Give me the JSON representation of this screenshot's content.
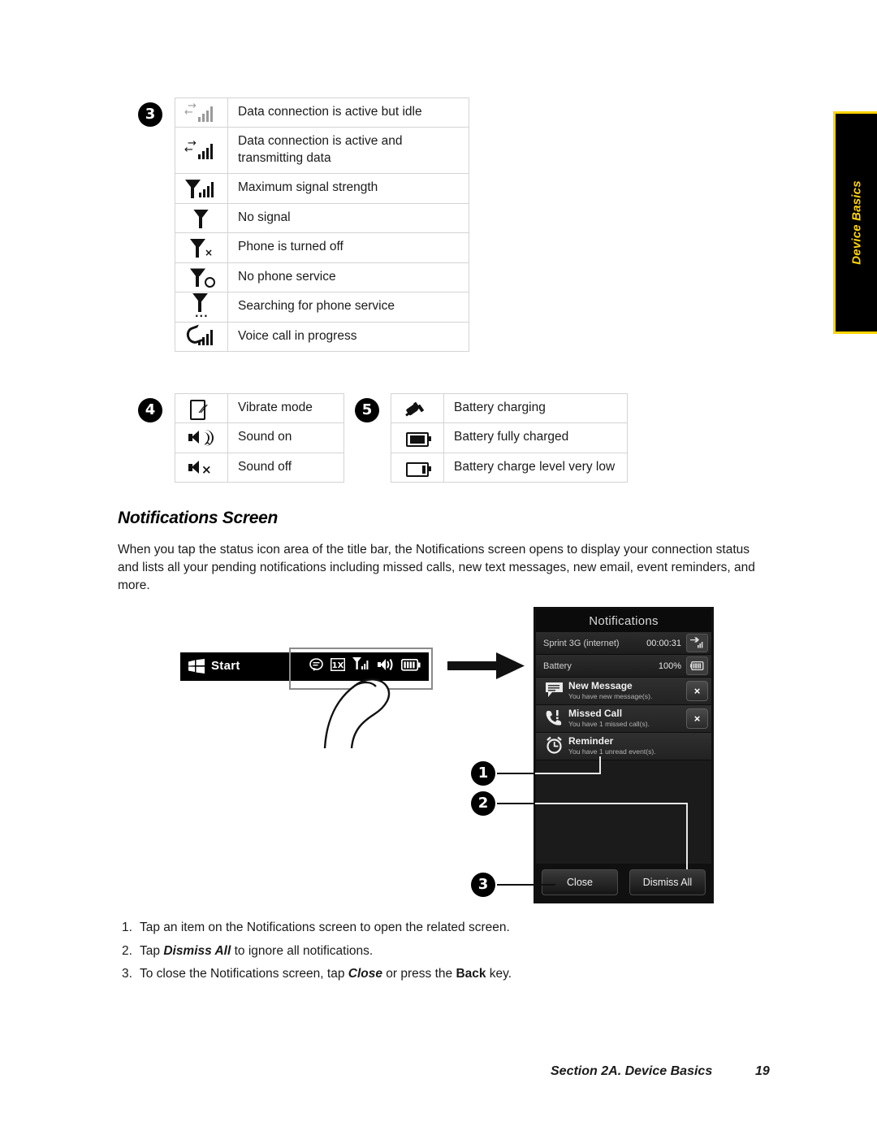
{
  "side_tab": {
    "label": "Device Basics",
    "bg": "#000000",
    "accent": "#ffd400"
  },
  "tables": [
    {
      "callout": "3",
      "rows": [
        {
          "icon": "data-connection-idle-icon",
          "text": "Data connection is active but idle"
        },
        {
          "icon": "data-connection-transmitting-icon",
          "text": "Data connection is active and transmitting data"
        },
        {
          "icon": "signal-max-icon",
          "text": "Maximum signal strength"
        },
        {
          "icon": "no-signal-icon",
          "text": "No signal"
        },
        {
          "icon": "phone-off-icon",
          "text": "Phone is turned off"
        },
        {
          "icon": "no-phone-service-icon",
          "text": "No phone service"
        },
        {
          "icon": "searching-service-icon",
          "text": "Searching for phone service"
        },
        {
          "icon": "voice-call-icon",
          "text": "Voice call in progress"
        }
      ]
    },
    {
      "callout": "4",
      "rows": [
        {
          "icon": "vibrate-icon",
          "text": "Vibrate mode"
        },
        {
          "icon": "sound-on-icon",
          "text": "Sound on"
        },
        {
          "icon": "sound-off-icon",
          "text": "Sound off"
        }
      ]
    },
    {
      "callout": "5",
      "rows": [
        {
          "icon": "battery-charging-icon",
          "text": "Battery charging"
        },
        {
          "icon": "battery-full-icon",
          "text": "Battery fully charged"
        },
        {
          "icon": "battery-low-icon",
          "text": "Battery charge level very low"
        }
      ]
    }
  ],
  "section": {
    "heading": "Notifications Screen",
    "paragraph": "When you tap the status icon area of the title bar, the Notifications screen opens to display your connection status and lists all your pending notifications including missed calls, new text messages, new email, event reminders, and more."
  },
  "illustration": {
    "titlebar": {
      "start_label": "Start",
      "icons": [
        "messaging-icon",
        "1x-icon",
        "signal-icon",
        "sound-on-icon",
        "battery-icon"
      ],
      "onex_label": "1X"
    },
    "callouts": [
      "1",
      "2",
      "3"
    ]
  },
  "phone": {
    "title": "Notifications",
    "status_rows": [
      {
        "label": "Sprint 3G (internet)",
        "value": "00:00:31",
        "icon": "data-connection-icon"
      },
      {
        "label": "Battery",
        "value": "100%",
        "icon": "battery-full-icon"
      }
    ],
    "notifications": [
      {
        "icon": "message-icon",
        "title": "New Message",
        "detail": "You have new message(s).",
        "dismiss": "×"
      },
      {
        "icon": "missed-call-icon",
        "title": "Missed Call",
        "detail": "You have 1 missed call(s).",
        "dismiss": "×"
      },
      {
        "icon": "alarm-icon",
        "title": "Reminder",
        "detail": "You have 1 unread event(s).",
        "dismiss": ""
      }
    ],
    "buttons": {
      "close": "Close",
      "dismiss_all": "Dismiss All"
    }
  },
  "steps": [
    {
      "num": "1.",
      "pre": "Tap an item on the Notifications screen to open the related screen.",
      "em": "",
      "post": ""
    },
    {
      "num": "2.",
      "pre": "Tap ",
      "em": "Dismiss All",
      "post": " to ignore all notifications."
    },
    {
      "num": "3.",
      "pre": "To close the Notifications screen, tap ",
      "em": "Close",
      "post": " or press the Back key."
    }
  ],
  "step3": {
    "lead": "To close the Notifications screen, tap ",
    "em1": "Close",
    "mid": " or press the ",
    "bold1": "Back",
    "tail": " key."
  },
  "footer": {
    "section": "Section 2A. Device Basics",
    "page": "19"
  }
}
